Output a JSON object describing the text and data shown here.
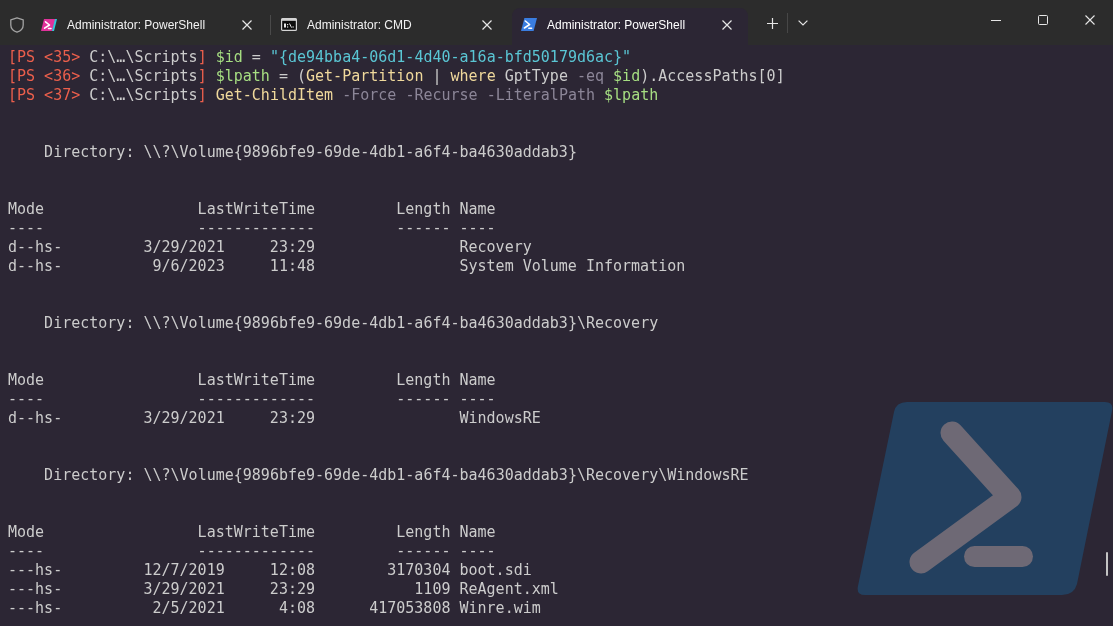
{
  "tab_bar": {
    "tabs": [
      {
        "kind": "preview",
        "title": "Administrator: PowerShell",
        "selected": false
      },
      {
        "kind": "cmd",
        "title": "Administrator: CMD",
        "selected": false
      },
      {
        "kind": "powershell",
        "title": "Administrator: PowerShell",
        "selected": true
      }
    ]
  },
  "terminal": {
    "commands": [
      {
        "words": [
          [
            {
              "kind": "prompt",
              "text": "[PS <35>"
            }
          ],
          [
            {
              "kind": "path",
              "text": "C:\\…\\Scripts"
            },
            {
              "kind": "prompt",
              "text": "]"
            }
          ],
          [
            {
              "kind": "variable",
              "text": "$id"
            }
          ],
          [
            {
              "kind": "plain",
              "text": "="
            }
          ],
          [
            {
              "kind": "string",
              "text": "\"{de94bba4-06d1-4d40-a16a-bfd50179d6ac}\""
            }
          ]
        ]
      },
      {
        "words": [
          [
            {
              "kind": "prompt",
              "text": "[PS <36>"
            }
          ],
          [
            {
              "kind": "path",
              "text": "C:\\…\\Scripts"
            },
            {
              "kind": "prompt",
              "text": "]"
            }
          ],
          [
            {
              "kind": "variable",
              "text": "$lpath"
            }
          ],
          [
            {
              "kind": "plain",
              "text": "="
            }
          ],
          [
            {
              "kind": "plain",
              "text": "("
            },
            {
              "kind": "command",
              "text": "Get-Partition"
            }
          ],
          [
            {
              "kind": "plain",
              "text": "|"
            }
          ],
          [
            {
              "kind": "command",
              "text": "where"
            }
          ],
          [
            {
              "kind": "plain",
              "text": "GptType"
            }
          ],
          [
            {
              "kind": "parameter",
              "text": "-eq"
            }
          ],
          [
            {
              "kind": "variable",
              "text": "$id"
            },
            {
              "kind": "plain",
              "text": ").AccessPaths[0]"
            }
          ]
        ]
      },
      {
        "words": [
          [
            {
              "kind": "prompt",
              "text": "[PS <37>"
            }
          ],
          [
            {
              "kind": "path",
              "text": "C:\\…\\Scripts"
            },
            {
              "kind": "prompt",
              "text": "]"
            }
          ],
          [
            {
              "kind": "command",
              "text": "Get-ChildItem"
            }
          ],
          [
            {
              "kind": "parameter",
              "text": "-Force"
            }
          ],
          [
            {
              "kind": "parameter",
              "text": "-Recurse"
            }
          ],
          [
            {
              "kind": "parameter",
              "text": "-LiteralPath"
            }
          ],
          [
            {
              "kind": "variable",
              "text": "$lpath"
            }
          ]
        ]
      }
    ],
    "sections": [
      {
        "directory": "Directory: \\\\?\\Volume{9896bfe9-69de-4db1-a6f4-ba4630addab3}",
        "columns": [
          {
            "label": "Mode",
            "rule": "----"
          },
          {
            "label": "LastWriteTime",
            "rule": "-------------"
          },
          {
            "label": "Length",
            "rule": "------"
          },
          {
            "label": "Name",
            "rule": "----"
          }
        ],
        "rows": [
          {
            "mode": "d--hs-",
            "date": "3/29/2021",
            "time": "23:29",
            "name": "Recovery"
          },
          {
            "mode": "d--hs-",
            "date": "9/6/2023",
            "time": "11:48",
            "name": "System Volume Information"
          }
        ]
      },
      {
        "directory": "Directory: \\\\?\\Volume{9896bfe9-69de-4db1-a6f4-ba4630addab3}\\Recovery",
        "columns": [
          {
            "label": "Mode",
            "rule": "----"
          },
          {
            "label": "LastWriteTime",
            "rule": "-------------"
          },
          {
            "label": "Length",
            "rule": "------"
          },
          {
            "label": "Name",
            "rule": "----"
          }
        ],
        "rows": [
          {
            "mode": "d--hs-",
            "date": "3/29/2021",
            "time": "23:29",
            "name": "WindowsRE"
          }
        ]
      },
      {
        "directory": "Directory: \\\\?\\Volume{9896bfe9-69de-4db1-a6f4-ba4630addab3}\\Recovery\\WindowsRE",
        "columns": [
          {
            "label": "Mode",
            "rule": "----"
          },
          {
            "label": "LastWriteTime",
            "rule": "-------------"
          },
          {
            "label": "Length",
            "rule": "------"
          },
          {
            "label": "Name",
            "rule": "----"
          }
        ],
        "rows": [
          {
            "mode": "---hs-",
            "date": "12/7/2019",
            "time": "12:08",
            "length": "3170304",
            "name": "boot.sdi"
          },
          {
            "mode": "---hs-",
            "date": "3/29/2021",
            "time": "23:29",
            "length": "1109",
            "name": "ReAgent.xml"
          },
          {
            "mode": "---hs-",
            "date": "2/5/2021",
            "time": "4:08",
            "length": "417053808",
            "name": "Winre.wim"
          }
        ]
      }
    ]
  }
}
